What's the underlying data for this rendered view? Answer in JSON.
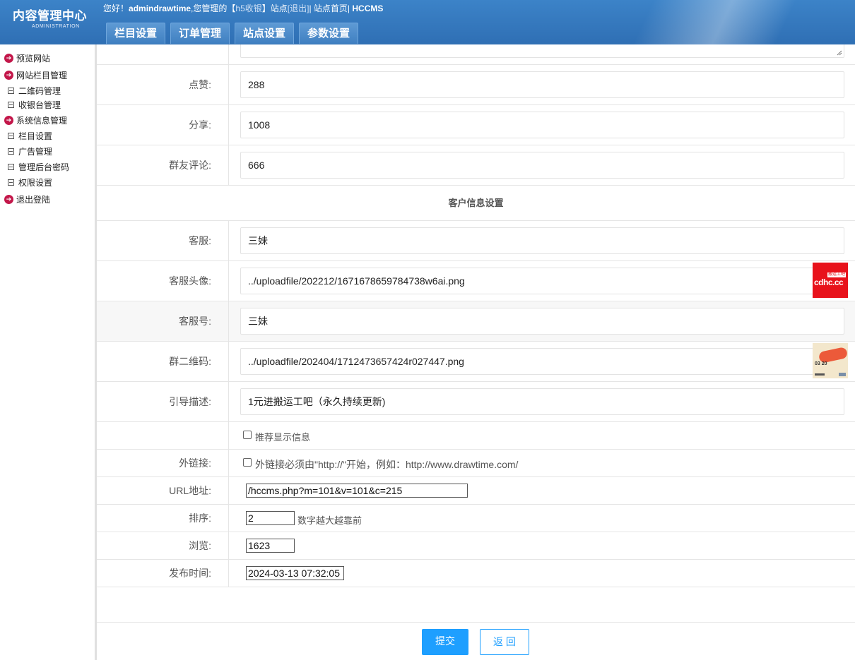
{
  "header": {
    "title": "内容管理中心",
    "subtitle": "ADMINISTRATION",
    "greeting": "您好！",
    "username": "admindrawtime",
    "managing": ",您管理的【",
    "site": "h5收银",
    "site_suffix": "】站点",
    "logout": "[退出]",
    "sep1": "|",
    "home": "站点首页",
    "sep2": "|",
    "brand": "HCCMS"
  },
  "nav": [
    "栏目设置",
    "订单管理",
    "站点设置",
    "参数设置"
  ],
  "sidebar": [
    {
      "label": "预览网站",
      "type": "dot"
    },
    {
      "label": "网站栏目管理",
      "type": "dot"
    },
    {
      "label": "二维码管理",
      "type": "box"
    },
    {
      "label": "收银台管理",
      "type": "box"
    },
    {
      "label": "系统信息管理",
      "type": "dot"
    },
    {
      "label": "栏目设置",
      "type": "box"
    },
    {
      "label": "广告管理",
      "type": "box"
    },
    {
      "label": "管理后台密码",
      "type": "box"
    },
    {
      "label": "权限设置",
      "type": "box"
    },
    {
      "label": "退出登陆",
      "type": "dot"
    }
  ],
  "form": {
    "likes_label": "点赞:",
    "likes": "288",
    "shares_label": "分享:",
    "shares": "1008",
    "comments_label": "群友评论:",
    "comments": "666",
    "section_title": "客户信息设置",
    "service_label": "客服:",
    "service": "三妹",
    "avatar_label": "客服头像:",
    "avatar": "../uploadfile/202212/1671678659784738w6ai.png",
    "service_id_label": "客服号:",
    "service_id": "三妹",
    "group_qr_label": "群二维码:",
    "group_qr": "../uploadfile/202404/1712473657424r027447.png",
    "guide_label": "引导描述:",
    "guide": "1元进搬运工吧（永久持续更新)",
    "recommend_label": "推荐显示信息",
    "external_label": "外链接:",
    "external_hint": "外链接必须由\"http://\"开始，例如：http://www.drawtime.com/",
    "url_label": "URL地址:",
    "url": "/hccms.php?m=101&v=101&c=215",
    "sort_label": "排序:",
    "sort": "2",
    "sort_hint": "数字越大越靠前",
    "views_label": "浏览:",
    "views": "1623",
    "publish_label": "发布时间:",
    "publish": "2024-03-13 07:32:05"
  },
  "avatar_thumb_text": "cdhc.cc",
  "avatar_thumb_badge": "搬运工吧",
  "qr_thumb_text": "03 20",
  "buttons": {
    "submit": "提交",
    "back": "返 回"
  },
  "colors": {
    "header": "#3578bd",
    "accent": "#1e9fff",
    "sidebar_dot": "#c3174a"
  }
}
